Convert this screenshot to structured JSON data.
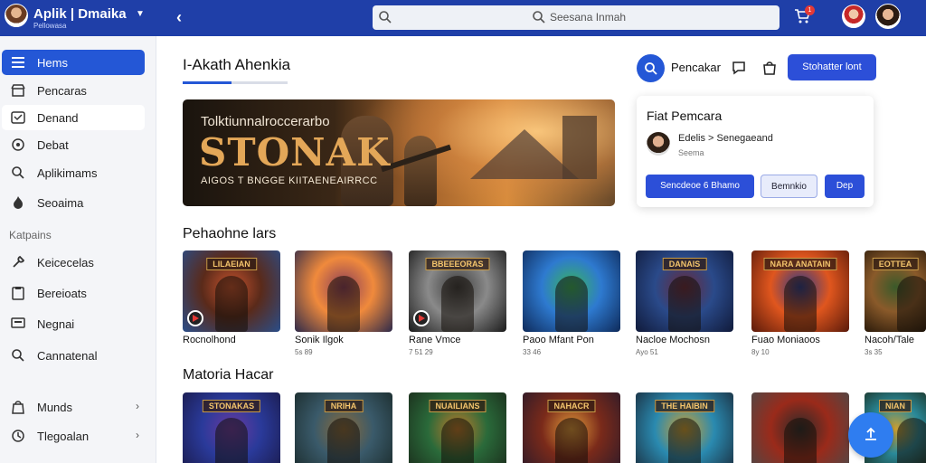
{
  "topbar": {
    "app_title": "Aplik | Dmaika",
    "app_subtitle": "Pellowasa",
    "search_placeholder": "Seesana Inmah",
    "cart_count": "1",
    "colors": {
      "bar": "#1f3fa8",
      "accent": "#2457d6"
    }
  },
  "sidebar": {
    "items": [
      {
        "label": "Hems",
        "icon": "menu-icon"
      },
      {
        "label": "Pencaras",
        "icon": "store-icon"
      },
      {
        "label": "Denand",
        "icon": "library-icon"
      },
      {
        "label": "Debat",
        "icon": "gamepad-icon"
      },
      {
        "label": "Aplikimams",
        "icon": "search-icon"
      },
      {
        "label": "Seoaima",
        "icon": "fire-icon"
      }
    ],
    "section_label": "Katpains",
    "category_items": [
      {
        "label": "Keicecelas",
        "icon": "wrench-icon"
      },
      {
        "label": "Bereioats",
        "icon": "clipboard-icon"
      },
      {
        "label": "Negnai",
        "icon": "monitor-icon"
      },
      {
        "label": "Cannatenal",
        "icon": "search-user-icon"
      }
    ],
    "bottom_items": [
      {
        "label": "Munds",
        "icon": "bag-icon"
      },
      {
        "label": "Tlegoalan",
        "icon": "clock-icon"
      }
    ]
  },
  "main": {
    "title": "I-Akath  Ahenkia",
    "search_label": "Pencakar",
    "cta_label": "Stohatter lont"
  },
  "hero": {
    "eyebrow": "Tolktiunnalroccerarbo",
    "title": "STONAK",
    "tagline": "AIGOS T BNGGE KIITAENEAIRRCC"
  },
  "popup": {
    "title": "Fiat Pemcara",
    "name": "Edelis > Senegaeand",
    "sub": "Seema",
    "primary_label": "Sencdeoe 6 Bhamo",
    "secondary_label": "Bemnkio",
    "tertiary_label": "Dep"
  },
  "sections": [
    {
      "title": "Pehaohne lars",
      "tiles": [
        {
          "title": "Rocnolhond",
          "meta": "",
          "label": "LILAEIAN",
          "colors": [
            "#5a2a1a",
            "#c6532e",
            "#2a4e8a"
          ]
        },
        {
          "title": "Sonik Ilgok",
          "meta": "5s 89",
          "label": "",
          "colors": [
            "#f08a3c",
            "#8a3e5a",
            "#2e2a4a"
          ]
        },
        {
          "title": "Rane Vmce",
          "meta": "7 51 29",
          "label": "BBEEEORAS",
          "colors": [
            "#8a8a8a",
            "#3a3a3a",
            "#1a1a1a"
          ]
        },
        {
          "title": "Paoo Mfant Pon",
          "meta": "33 46",
          "label": "",
          "colors": [
            "#2e7ad0",
            "#39b45a",
            "#0e2a5a"
          ]
        },
        {
          "title": "Nacloe Mochosn",
          "meta": "Ayo 51",
          "label": "DANAIS",
          "colors": [
            "#2a4a8a",
            "#6a2a3a",
            "#101a3a"
          ]
        },
        {
          "title": "Fuao Moniaoos",
          "meta": "8y 10",
          "label": "NARA ANATAIN",
          "colors": [
            "#e0561e",
            "#2a3a8a",
            "#5a1a0a"
          ]
        },
        {
          "title": "Nacoh/Tale",
          "meta": "3s 35",
          "label": "EOTTEA",
          "colors": [
            "#8a5a2a",
            "#3a5a2a",
            "#2a1a0a"
          ]
        }
      ]
    },
    {
      "title": "Matoria Hacar",
      "tiles": [
        {
          "title": "",
          "meta": "",
          "label": "STONAKAS",
          "colors": [
            "#2a3a9a",
            "#6a3aa0",
            "#1a1a4a"
          ]
        },
        {
          "title": "",
          "meta": "",
          "label": "NRIHA",
          "colors": [
            "#3a5a6a",
            "#8a6a3a",
            "#1a2a2a"
          ]
        },
        {
          "title": "",
          "meta": "",
          "label": "NUAILIANS",
          "colors": [
            "#2a6a3a",
            "#c07a2a",
            "#1a2a1a"
          ]
        },
        {
          "title": "",
          "meta": "",
          "label": "NAHACR",
          "colors": [
            "#7a2a1a",
            "#e09a3a",
            "#2a1a2a"
          ]
        },
        {
          "title": "",
          "meta": "",
          "label": "THE HAIBIN",
          "colors": [
            "#2a8ab0",
            "#d0a030",
            "#1a2a3a"
          ]
        },
        {
          "title": "",
          "meta": "",
          "label": "",
          "colors": [
            "#9a2a1a",
            "#2a2a2a",
            "#4a4a4a"
          ]
        },
        {
          "title": "",
          "meta": "",
          "label": "NIAN",
          "colors": [
            "#2a8a9a",
            "#d0a030",
            "#1a2a1a"
          ]
        }
      ]
    }
  ]
}
